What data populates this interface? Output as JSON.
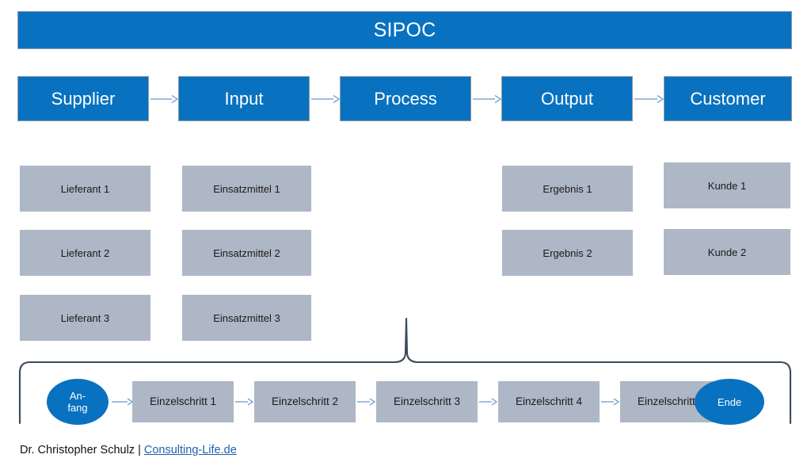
{
  "title": {
    "text": "SIPOC"
  },
  "colors": {
    "blue": "#0972C0",
    "gray": "#AEB7C6",
    "arrow": "#7FA9D6",
    "brace": "#3B4A5E",
    "link": "#1F5FAF",
    "text_dark": "#1a1a1a",
    "text_light": "#ffffff"
  },
  "header": {
    "boxes": [
      {
        "label": "Supplier"
      },
      {
        "label": "Input"
      },
      {
        "label": "Process"
      },
      {
        "label": "Output"
      },
      {
        "label": "Customer"
      }
    ]
  },
  "columns": [
    {
      "key": "supplier",
      "items": [
        {
          "label": "Lieferant 1"
        },
        {
          "label": "Lieferant 2"
        },
        {
          "label": "Lieferant 3"
        }
      ]
    },
    {
      "key": "input",
      "items": [
        {
          "label": "Einsatzmittel 1"
        },
        {
          "label": "Einsatzmittel 2"
        },
        {
          "label": "Einsatzmittel 3"
        }
      ]
    },
    {
      "key": "process",
      "items": []
    },
    {
      "key": "output",
      "items": [
        {
          "label": "Ergebnis 1"
        },
        {
          "label": "Ergebnis 2"
        }
      ]
    },
    {
      "key": "customer",
      "items": [
        {
          "label": "Kunde 1"
        },
        {
          "label": "Kunde 2"
        }
      ]
    }
  ],
  "process_flow": {
    "start": {
      "label": "An-\nfang"
    },
    "steps": [
      {
        "label": "Einzelschritt 1"
      },
      {
        "label": "Einzelschritt 2"
      },
      {
        "label": "Einzelschritt 3"
      },
      {
        "label": "Einzelschritt 4"
      },
      {
        "label": "Einzelschritt 5"
      }
    ],
    "end": {
      "label": "Ende"
    }
  },
  "footer": {
    "author": "Dr. Christopher Schulz",
    "separator": " | ",
    "link": "Consulting-Life.de"
  }
}
